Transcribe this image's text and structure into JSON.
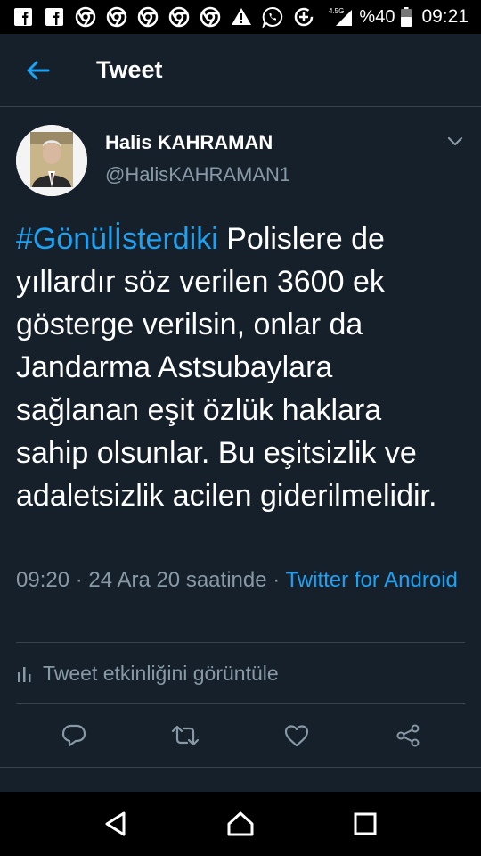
{
  "status_bar": {
    "battery_text": "%40",
    "time": "09:21",
    "network": "4.5G",
    "left_icons": [
      "facebook-icon",
      "facebook-icon",
      "chrome-icon",
      "chrome-icon",
      "chrome-icon",
      "chrome-icon",
      "chrome-icon",
      "warning-icon",
      "whatsapp-icon",
      "data-saver-icon"
    ]
  },
  "header": {
    "title": "Tweet"
  },
  "tweet": {
    "author_name": "Halis KAHRAMAN",
    "author_handle": "@HalisKAHRAMAN1",
    "hashtag": "#GönülİsterdikiPolislere",
    "hashtag_display": "#Gönülİsterdiki",
    "body": " Polislere de yıllardır söz verilen 3600 ek gösterge verilsin, onlar da Jandarma Astsubaylara sağlanan eşit özlük haklara sahip olsunlar. Bu eşitsizlik ve adaletsizlik acilen giderilmelidir.",
    "time": "09:20",
    "date": "24 Ara 20 saatinde",
    "separator": "·",
    "source": "Twitter for Android",
    "activity_label": "Tweet etkinliğini görüntüle"
  },
  "colors": {
    "background": "#15202b",
    "accent": "#1da1f2",
    "secondary_text": "#8899a6",
    "divider": "#38444d"
  }
}
